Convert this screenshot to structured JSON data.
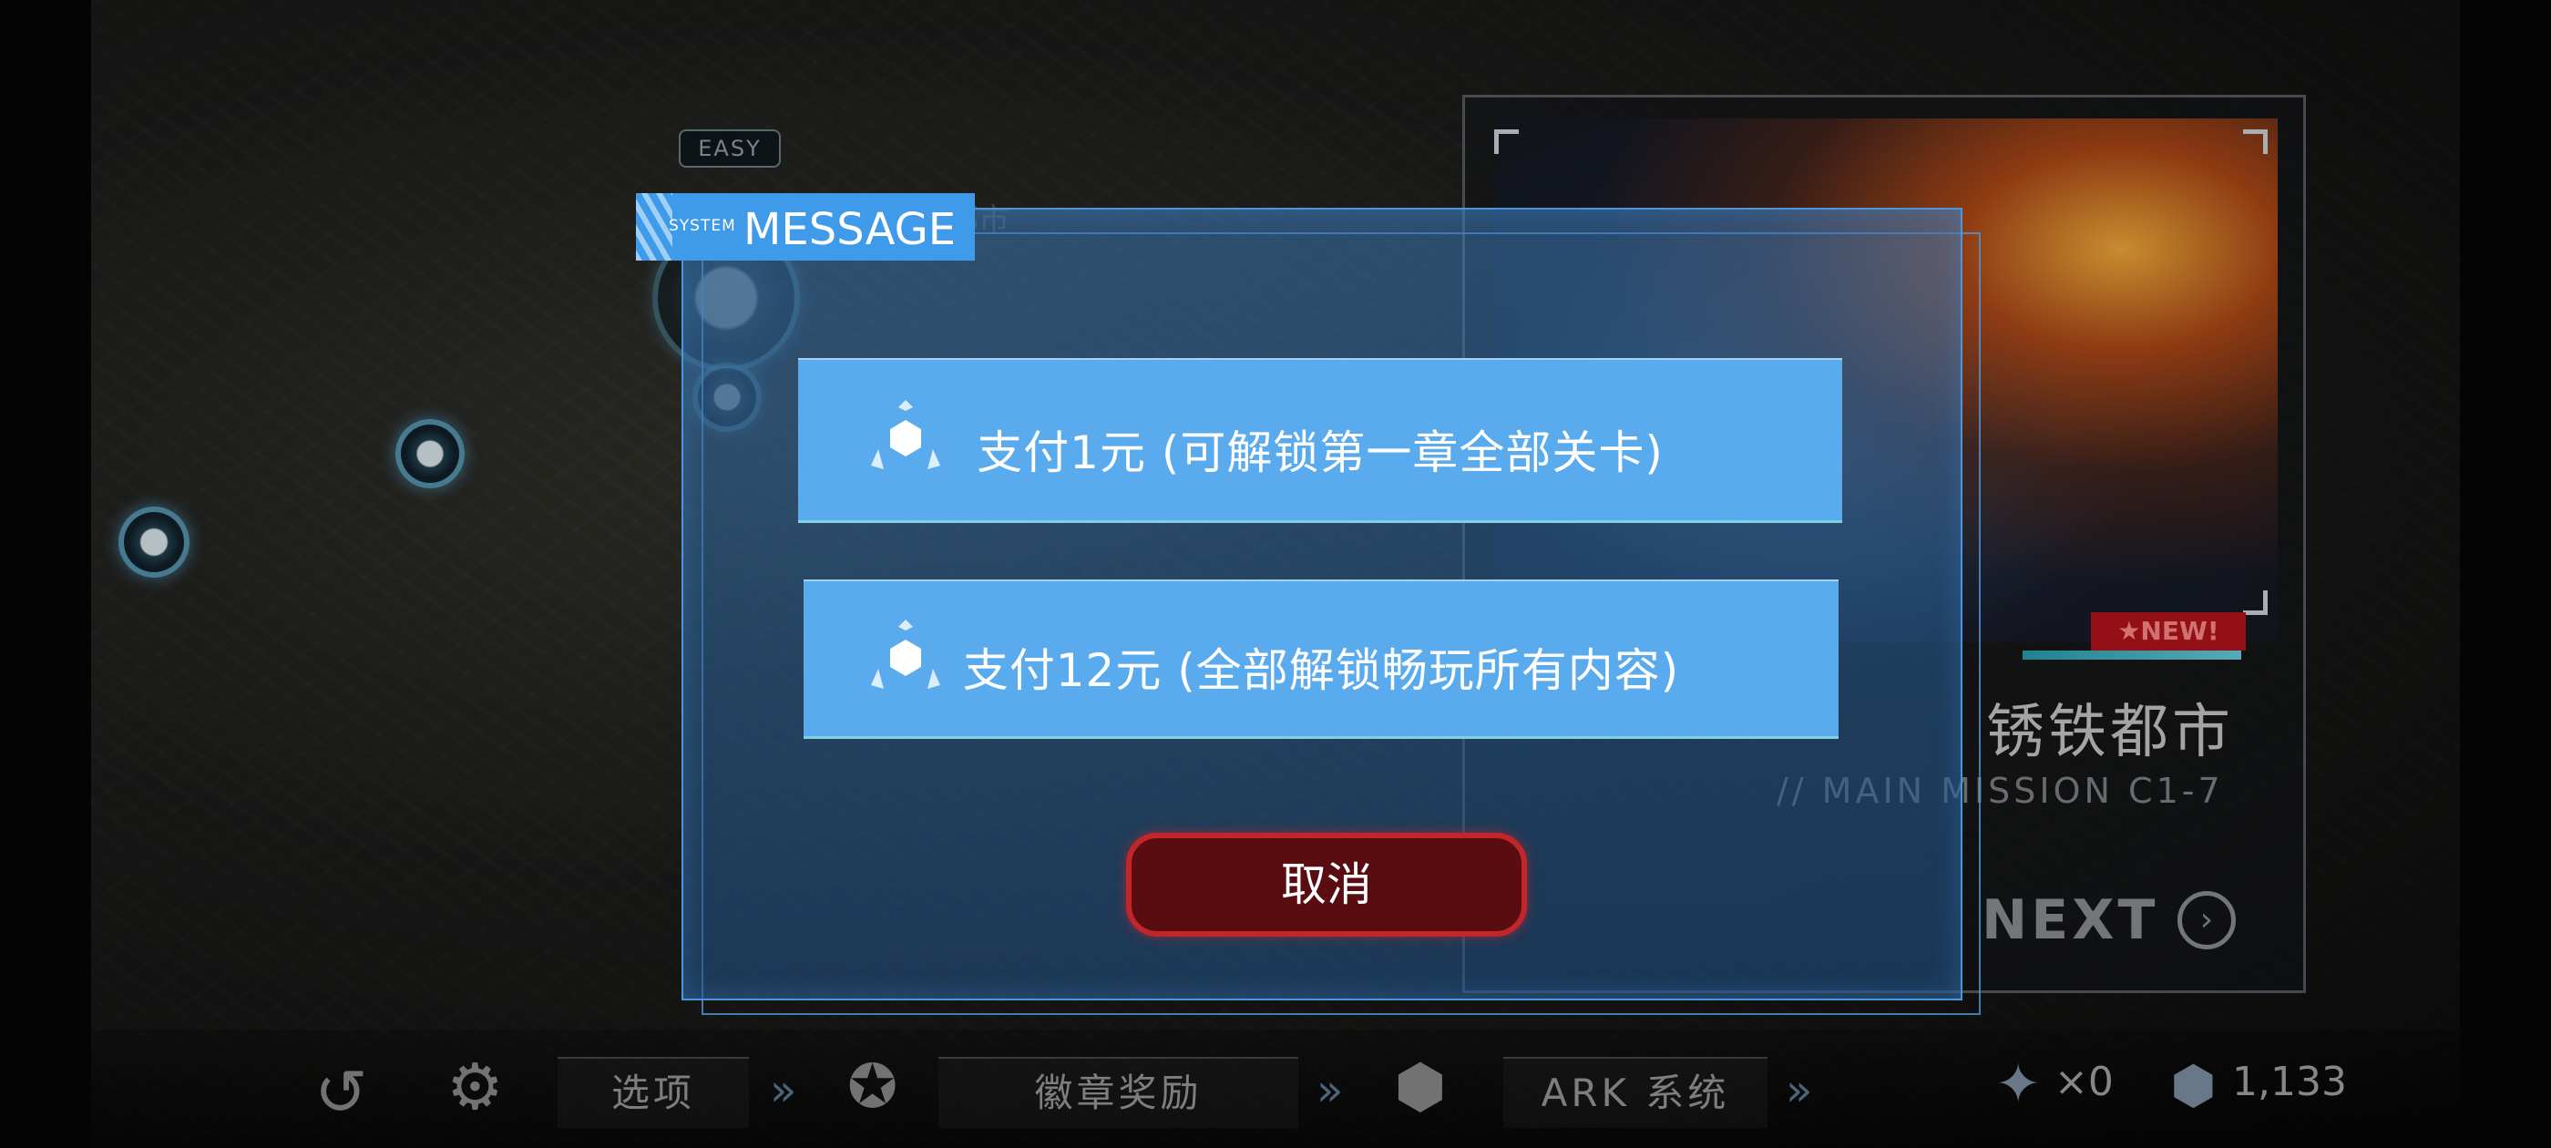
{
  "background": {
    "difficulty_tag": "EASY",
    "ghost_title": "都市",
    "mission_card": {
      "new_badge": "★NEW!",
      "title": "锈铁都市",
      "subtitle": "// MAIN MISSION C1-7",
      "next_label": "NEXT"
    }
  },
  "dialog": {
    "header_prefix": "SYSTEM",
    "header_title": "MESSAGE",
    "options": [
      {
        "label": "支付1元 (可解锁第一章全部关卡)",
        "icon": "ark-crystal-icon"
      },
      {
        "label": "支付12元 (全部解锁畅玩所有内容)",
        "icon": "ark-crystal-icon"
      }
    ],
    "cancel_label": "取消"
  },
  "bottom_bar": {
    "options_label": "选项",
    "badge_reward_label": "徽章奖励",
    "ark_system_label": "ARK 系统",
    "badge_count": "×0",
    "currency_count": "1,133"
  },
  "colors": {
    "dialog_accent": "#3f9be9",
    "option_button": "#5aabee",
    "cancel_border": "#c2262b",
    "new_badge": "#b3141c"
  }
}
